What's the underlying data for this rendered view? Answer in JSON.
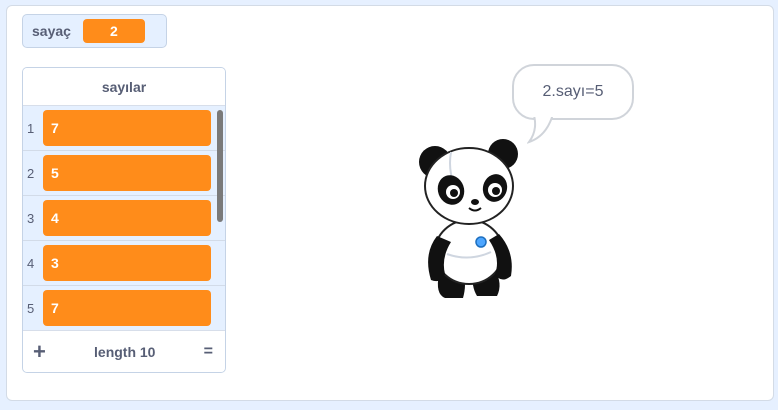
{
  "variable": {
    "name": "sayaç",
    "value": "2"
  },
  "list": {
    "title": "sayılar",
    "items": [
      {
        "index": "1",
        "value": "7"
      },
      {
        "index": "2",
        "value": "5"
      },
      {
        "index": "3",
        "value": "4"
      },
      {
        "index": "4",
        "value": "3"
      },
      {
        "index": "5",
        "value": "7"
      }
    ],
    "add_symbol": "+",
    "length_label": "length 10",
    "resize_symbol": "="
  },
  "sprite": {
    "name_icon": "panda-sprite",
    "speech": "2.sayı=5"
  },
  "colors": {
    "accent": "#ff8c1a",
    "text": "#575e75",
    "stage_bg": "#ffffff",
    "monitor_bg": "#e5f0ff"
  }
}
